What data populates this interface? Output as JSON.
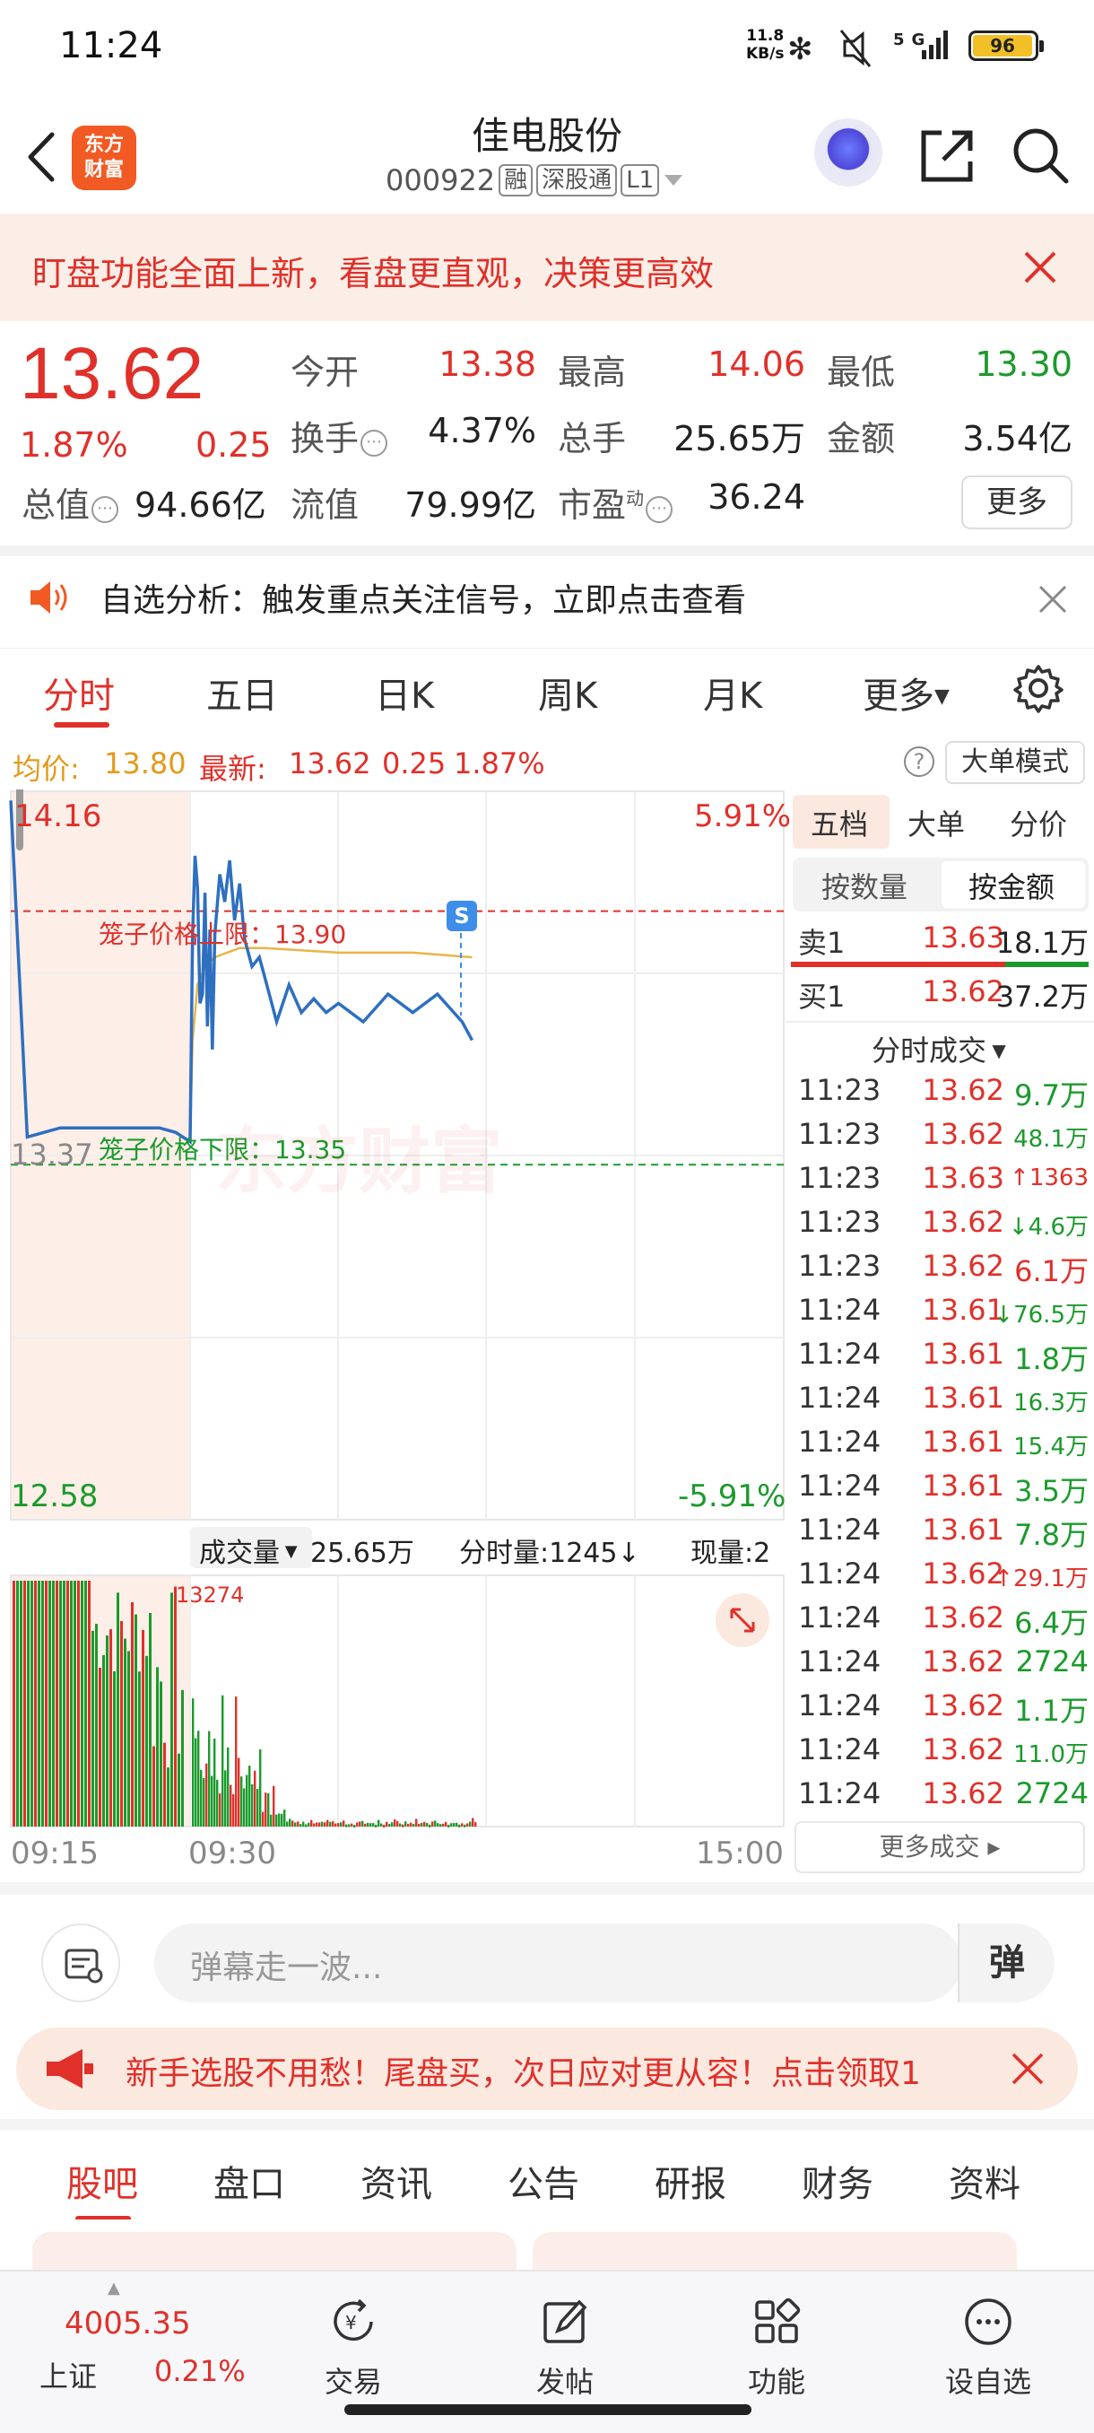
{
  "status_bar": {
    "time": "11:24",
    "net_speed_value": "11.8",
    "net_speed_unit": "KB/s",
    "battery": "96"
  },
  "header": {
    "logo_line1": "东方",
    "logo_line2": "财富",
    "stock_name": "佳电股份",
    "stock_code": "000922",
    "tags": [
      "融",
      "深股通",
      "L1"
    ]
  },
  "banner": {
    "text": "盯盘功能全面上新，看盘更直观，决策更高效"
  },
  "quote": {
    "price": "13.62",
    "change_pct": "1.87%",
    "change_abs": "0.25",
    "open_label": "今开",
    "open": "13.38",
    "high_label": "最高",
    "high": "14.06",
    "low_label": "最低",
    "low": "13.30",
    "turnover_label": "换手",
    "turnover": "4.37%",
    "volume_label": "总手",
    "volume": "25.65万",
    "amount_label": "金额",
    "amount": "3.54亿",
    "mktcap_label": "总值",
    "mktcap": "94.66亿",
    "float_label": "流值",
    "float": "79.99亿",
    "pe_label": "市盈",
    "pe_sup": "动",
    "pe": "36.24",
    "more_label": "更多"
  },
  "alert": {
    "text": "自选分析：触发重点关注信号，立即点击查看"
  },
  "tabs": [
    "分时",
    "五日",
    "日K",
    "周K",
    "月K",
    "更多"
  ],
  "chart_header": {
    "avg_label": "均价:",
    "avg": "13.80",
    "latest_label": "最新:",
    "latest": "13.62",
    "chg": "0.25",
    "pct": "1.87%",
    "big_order": "大单模式"
  },
  "chart_labels": {
    "y_top": "14.16",
    "y_bottom": "12.58",
    "y_mid": "13.37",
    "pct_top": "5.91%",
    "pct_bottom": "-5.91%",
    "upper_limit": "笼子价格上限：13.90",
    "lower_limit": "笼子价格下限：13.35",
    "watermark": "东方财富",
    "s_marker": "S",
    "vol_label": "成交量",
    "vol_total": "25.65万",
    "vol_min": "分时量:1245",
    "vol_now": "现量:2",
    "vol_peak": "13274",
    "x_start": "09:15",
    "x_mid": "09:30",
    "x_end": "15:00"
  },
  "side_panel": {
    "tabs": [
      "五档",
      "大单",
      "分价"
    ],
    "sub_tabs": [
      "按数量",
      "按金额"
    ],
    "sell1": {
      "label": "卖1",
      "price": "13.63",
      "amount": "18.1万"
    },
    "buy1": {
      "label": "买1",
      "price": "13.62",
      "amount": "37.2万"
    },
    "ticks_title": "分时成交",
    "ticks": [
      {
        "t": "11:23",
        "p": "13.62",
        "arrow": "",
        "v": "9.7万",
        "c": "green"
      },
      {
        "t": "11:23",
        "p": "13.62",
        "arrow": "",
        "v": "48.1万",
        "c": "green"
      },
      {
        "t": "11:23",
        "p": "13.63",
        "arrow": "↑",
        "v": "1363",
        "c": "red"
      },
      {
        "t": "11:23",
        "p": "13.62",
        "arrow": "↓",
        "v": "4.6万",
        "c": "green"
      },
      {
        "t": "11:23",
        "p": "13.62",
        "arrow": "",
        "v": "6.1万",
        "c": "red"
      },
      {
        "t": "11:24",
        "p": "13.61",
        "arrow": "↓",
        "v": "76.5万",
        "c": "green"
      },
      {
        "t": "11:24",
        "p": "13.61",
        "arrow": "",
        "v": "1.8万",
        "c": "green"
      },
      {
        "t": "11:24",
        "p": "13.61",
        "arrow": "",
        "v": "16.3万",
        "c": "green"
      },
      {
        "t": "11:24",
        "p": "13.61",
        "arrow": "",
        "v": "15.4万",
        "c": "green"
      },
      {
        "t": "11:24",
        "p": "13.61",
        "arrow": "",
        "v": "3.5万",
        "c": "green"
      },
      {
        "t": "11:24",
        "p": "13.61",
        "arrow": "",
        "v": "7.8万",
        "c": "green"
      },
      {
        "t": "11:24",
        "p": "13.62",
        "arrow": "↑",
        "v": "29.1万",
        "c": "red"
      },
      {
        "t": "11:24",
        "p": "13.62",
        "arrow": "",
        "v": "6.4万",
        "c": "green"
      },
      {
        "t": "11:24",
        "p": "13.62",
        "arrow": "",
        "v": "2724",
        "c": "green"
      },
      {
        "t": "11:24",
        "p": "13.62",
        "arrow": "",
        "v": "1.1万",
        "c": "green"
      },
      {
        "t": "11:24",
        "p": "13.62",
        "arrow": "",
        "v": "11.0万",
        "c": "green"
      },
      {
        "t": "11:24",
        "p": "13.62",
        "arrow": "",
        "v": "2724",
        "c": "green"
      }
    ],
    "more_ticks": "更多成交"
  },
  "comment": {
    "placeholder": "弹幕走一波...",
    "danmu": "弹"
  },
  "promo": {
    "text": "新手选股不用愁！尾盘买，次日应对更从容！点击领取1"
  },
  "bottom_tabs": [
    "股吧",
    "盘口",
    "资讯",
    "公告",
    "研报",
    "财务",
    "资料"
  ],
  "navbar": {
    "index_value": "4005.35",
    "index_name": "上证",
    "index_pct": "0.21%",
    "items": [
      "交易",
      "发帖",
      "功能",
      "设自选"
    ]
  },
  "colors": {
    "up": "#e0302a",
    "down": "#1b9a2c",
    "avg_line": "#e8b54a",
    "price_line": "#2e6fc0"
  },
  "chart_data": {
    "type": "line",
    "title": "",
    "y_range": [
      12.58,
      14.16
    ],
    "series": [
      {
        "name": "最新",
        "x": [
          "09:15",
          "09:16",
          "09:17",
          "09:18",
          "09:19",
          "09:20",
          "09:21",
          "09:22",
          "09:23",
          "09:24",
          "09:25",
          "09:30",
          "09:31",
          "09:32",
          "09:33",
          "09:34",
          "09:35",
          "09:36",
          "09:37",
          "09:38",
          "09:39",
          "09:40",
          "09:42",
          "09:44",
          "09:46",
          "09:48",
          "09:50",
          "09:52",
          "09:55",
          "09:58",
          "10:00",
          "10:05",
          "10:10",
          "10:15",
          "10:20",
          "10:25",
          "10:30",
          "10:40",
          "10:50",
          "11:00",
          "11:10",
          "11:20",
          "11:24"
        ],
        "values": [
          14.14,
          13.41,
          13.42,
          13.43,
          13.43,
          13.43,
          13.43,
          13.43,
          13.43,
          13.43,
          13.42,
          13.4,
          13.85,
          14.02,
          13.95,
          13.7,
          13.72,
          13.94,
          13.65,
          13.86,
          13.6,
          13.85,
          13.98,
          13.92,
          14.01,
          13.88,
          13.96,
          13.84,
          13.78,
          13.8,
          13.76,
          13.66,
          13.74,
          13.68,
          13.71,
          13.68,
          13.7,
          13.66,
          13.72,
          13.68,
          13.72,
          13.66,
          13.62
        ]
      },
      {
        "name": "均价",
        "x": [
          "09:30",
          "09:31",
          "09:33",
          "09:36",
          "09:40",
          "09:50",
          "10:00",
          "10:30",
          "11:00",
          "11:24"
        ],
        "values": [
          13.4,
          13.62,
          13.74,
          13.78,
          13.8,
          13.82,
          13.82,
          13.81,
          13.81,
          13.8
        ]
      }
    ],
    "volume": {
      "peak_label": "13274"
    },
    "reference_lines": {
      "upper_limit": 13.9,
      "lower_limit": 13.35
    }
  }
}
